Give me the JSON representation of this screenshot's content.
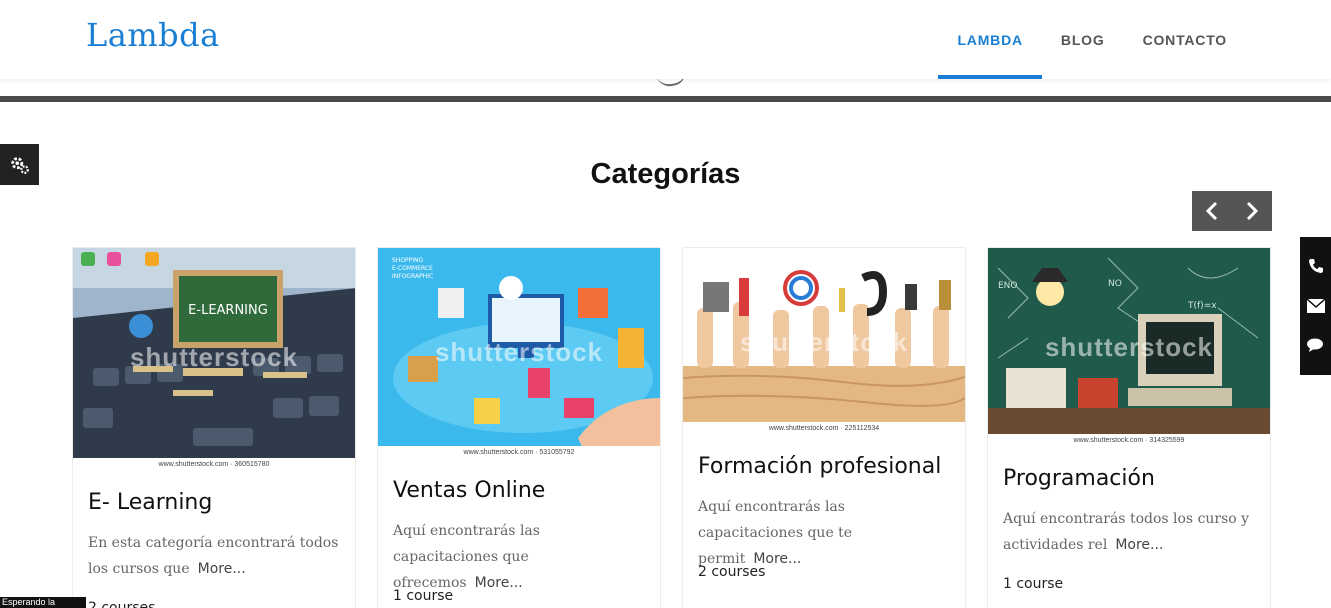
{
  "header": {
    "logo": "Lambda",
    "nav": [
      "LAMBDA",
      "BLOG",
      "CONTACTO"
    ],
    "brand_color": "#1a7fd4"
  },
  "section": {
    "title": "Categorías",
    "prev_icon": "chevron-left-icon",
    "next_icon": "chevron-right-icon"
  },
  "widgets": {
    "gear_icon": "gear-icon",
    "contact_icons": [
      "phone-icon",
      "mail-icon",
      "chat-icon"
    ]
  },
  "cards": [
    {
      "title": "E- Learning",
      "desc": "En esta categoría encontrará todos los cursos que",
      "more": "More...",
      "count": "2 courses",
      "credit": "www.shutterstock.com · 360515780",
      "watermark": "shutterstock"
    },
    {
      "title": "Ventas Online",
      "desc": "Aquí encontrarás las capacitaciones que ofrecemos",
      "more": "More...",
      "count": "1 course",
      "credit": "www.shutterstock.com · 531055792",
      "watermark": "shutterstock"
    },
    {
      "title": "Formación profesional",
      "desc": "Aquí encontrarás las capacitaciones que te permit",
      "more": "More...",
      "count": "2 courses",
      "credit": "www.shutterstock.com · 225112534",
      "watermark": "shutterstock"
    },
    {
      "title": "Programación",
      "desc": "Aquí encontrarás todos los curso y actividades rel",
      "more": "More...",
      "count": "1 course",
      "credit": "www.shutterstock.com · 314325599",
      "watermark": "shutterstock"
    }
  ],
  "status": {
    "loading_text": "Esperando la"
  }
}
